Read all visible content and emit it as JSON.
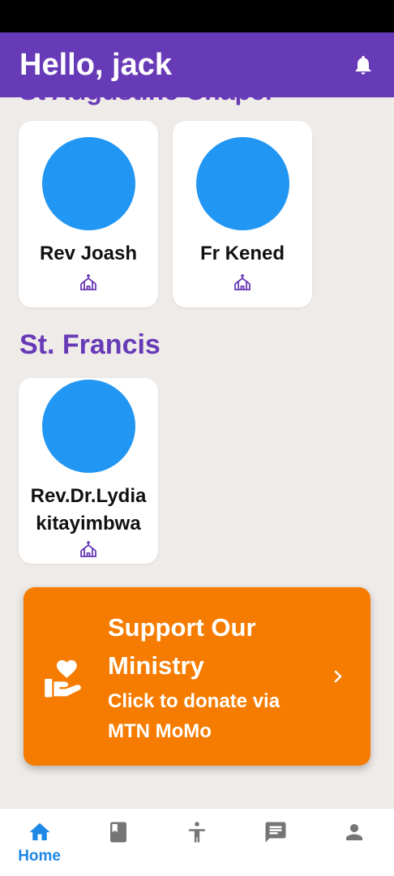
{
  "header": {
    "greeting": "Hello, jack"
  },
  "sections": [
    {
      "title": "St Augustine Chapel",
      "clergy": [
        "Rev Joash",
        "Fr Kened"
      ]
    },
    {
      "title": "St. Francis",
      "clergy": [
        "Rev.Dr.Lydia kitayimbwa"
      ]
    }
  ],
  "donate": {
    "title": "Support Our Ministry",
    "subtitle": "Click to donate via MTN MoMo"
  },
  "bottom_nav": {
    "items": [
      {
        "label": "Home",
        "icon": "home-icon",
        "active": true
      },
      {
        "label": "",
        "icon": "book-icon",
        "active": false
      },
      {
        "label": "",
        "icon": "person-pray-icon",
        "active": false
      },
      {
        "label": "",
        "icon": "chat-icon",
        "active": false
      },
      {
        "label": "",
        "icon": "account-icon",
        "active": false
      }
    ]
  },
  "colors": {
    "primary": "#673ab7",
    "avatar": "#2196f3",
    "donate": "#f57c00",
    "active_nav": "#1e88e5",
    "inactive_nav": "#757575",
    "background": "#efebe9"
  }
}
